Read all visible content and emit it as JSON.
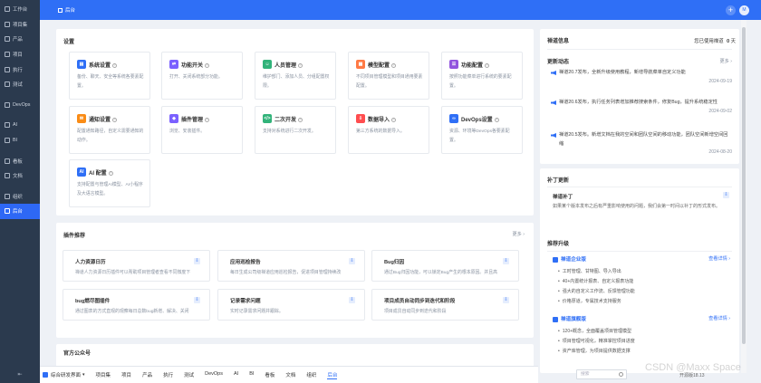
{
  "sidebar": {
    "items": [
      {
        "label": "工作台",
        "icon": "workbench-icon"
      },
      {
        "label": "项目集",
        "icon": "program-icon"
      },
      {
        "label": "产品",
        "icon": "product-icon"
      },
      {
        "label": "项目",
        "icon": "project-icon"
      },
      {
        "label": "执行",
        "icon": "execution-icon"
      },
      {
        "label": "测试",
        "icon": "test-icon"
      },
      {
        "label": "DevOps",
        "icon": "devops-icon"
      },
      {
        "label": "AI",
        "icon": "ai-icon"
      },
      {
        "label": "BI",
        "icon": "bi-icon"
      },
      {
        "label": "看板",
        "icon": "kanban-icon"
      },
      {
        "label": "文档",
        "icon": "doc-icon"
      },
      {
        "label": "组织",
        "icon": "org-icon"
      },
      {
        "label": "后台",
        "icon": "admin-icon"
      }
    ],
    "collapse": "⇤"
  },
  "topbar": {
    "breadcrumb": "后台",
    "avatar": "M",
    "plus": "+"
  },
  "settings": {
    "title": "设置",
    "cards": [
      {
        "title": "系统设置",
        "desc": "备份、聊天、安全等系统各要素配置。",
        "color": "#2f6ff6",
        "icon": "▤"
      },
      {
        "title": "功能开关",
        "desc": "打开、关闭系统部分功能。",
        "color": "#7b61ff",
        "icon": "⇄"
      },
      {
        "title": "人员管理",
        "desc": "维护部门、添加人员、分组配置权限。",
        "color": "#32b37a",
        "icon": "☺"
      },
      {
        "title": "模型配置",
        "desc": "不同项目管理模型和项目通用要素配置。",
        "color": "#ff7a45",
        "icon": "▦"
      },
      {
        "title": "功能配置",
        "desc": "按照功能菜单进行系统的要素配置。",
        "color": "#9254de",
        "icon": "☰"
      },
      {
        "title": "通知设置",
        "desc": "配置通知路径，自定义需要通知的动作。",
        "color": "#fa8c16",
        "icon": "✉"
      },
      {
        "title": "插件管理",
        "desc": "浏览、安装插件。",
        "color": "#7b61ff",
        "icon": "◆"
      },
      {
        "title": "二次开发",
        "desc": "支持对系统进行二次开发。",
        "color": "#32b37a",
        "icon": "</>"
      },
      {
        "title": "数据导入",
        "desc": "第三方系统的数据导入。",
        "color": "#ff4d4f",
        "icon": "⇩"
      },
      {
        "title": "DevOps设置",
        "desc": "资源、环境等DevOps各要素配置。",
        "color": "#2f6ff6",
        "icon": "∞"
      },
      {
        "title": "AI 配置",
        "desc": "支持配置与管理AI模型、AI小程序及大语言模型。",
        "color": "#2f6ff6",
        "icon": "AI"
      }
    ]
  },
  "plugins": {
    "title": "插件推荐",
    "more": "更多 ›",
    "items": [
      {
        "title": "人力资源日历",
        "desc": "禅道人力资源日历插件可以帮助项目管理者查看不同微度下"
      },
      {
        "title": "应用巡检报告",
        "desc": "每日生成公司级禅道应用巡检报告，促进项目管理持续改"
      },
      {
        "title": "Bug归因",
        "desc": "通过Bug归因功能，可以锁定Bug产生的根本原因。并且高"
      },
      {
        "title": "bug燃尽图插件",
        "desc": "通过图表的方式直观的观察每日总数bug新增、解决、关闭"
      },
      {
        "title": "记录需求问题",
        "desc": "实时记录需求问题并跟踪。"
      },
      {
        "title": "项目成员自动同步到迭代和阶段",
        "desc": "项目成员自动同步到迭代和阶段"
      }
    ]
  },
  "official": {
    "title": "官方公众号"
  },
  "zentao_info": {
    "title": "禅道信息",
    "usage_label": "您已使用禅道",
    "usage_value": "0",
    "usage_unit": "天",
    "updates_title": "更新动态",
    "updates_more": "更多 ›",
    "news": [
      {
        "text": "禅道20.7发布，全新升级使用教程，新增导航菜单自定义功能",
        "date": "2024-09-19"
      },
      {
        "text": "禅道20.6发布，执行任务列表增加推荐搜索条件，修复Bug，提升系统稳定性",
        "date": "2024-09-02"
      },
      {
        "text": "禅道20.5发布。新增文档在我的空间和团队空间的移动功能，团队空间新增空间回缩",
        "date": "2024-08-20"
      }
    ],
    "patch_title": "补丁更新",
    "patch_name": "禅道补丁",
    "patch_desc": "如果某个版本发布之后有严重影响使用的问题，我们会第一时间以补丁的形式发布。",
    "upgrade_title": "推荐升级",
    "editions": [
      {
        "name": "禅道企业版",
        "link": "查看详情 ›",
        "features": [
          "工时管理、甘特图、导入导出",
          "40+内置统计报表、自定义报表功能",
          "强大的自定义工作流、反馈管理功能",
          "价格厚道，专属技术支持服务"
        ]
      },
      {
        "name": "禅道旗舰版",
        "link": "查看详情 ›",
        "features": [
          "120+概念，全面覆盖项目管理模型",
          "项目管理可视化，精准掌控项目进度",
          "资产库管理，为项目提供数据支撑"
        ]
      }
    ]
  },
  "bottombar": {
    "mode": "综合研发界面",
    "tabs": [
      "项目集",
      "项目",
      "产品",
      "执行",
      "测试",
      "DevOps",
      "AI",
      "BI",
      "看板",
      "文档",
      "组织",
      "后台"
    ],
    "active_tab": "后台",
    "search_placeholder": "搜索",
    "version": "开源版18.13"
  },
  "watermark": "CSDN @Maxx Space"
}
